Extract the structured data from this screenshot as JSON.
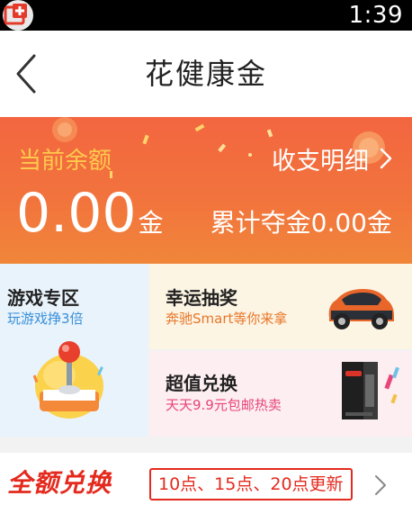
{
  "status_bar": {
    "time": "1:39",
    "app_icon": "app-plus-icon"
  },
  "nav": {
    "back_icon": "back-chevron-icon",
    "title": "花健康金"
  },
  "balance": {
    "label": "当前余额",
    "details_label": "收支明细",
    "amount": "0.00",
    "unit": "金",
    "total_won": "累计夺金0.00金",
    "colors": {
      "label": "#ffc94d",
      "banner_top": "#f36640",
      "banner_bottom": "#f0863a"
    }
  },
  "tiles": {
    "game": {
      "title": "游戏专区",
      "subtitle": "玩游戏挣3倍",
      "subtitle_color": "#3a8fd8",
      "icon": "joystick-icon"
    },
    "lottery": {
      "title": "幸运抽奖",
      "subtitle": "奔驰Smart等你来拿",
      "subtitle_color": "#e8762a",
      "icon": "smart-car-icon"
    },
    "exchange": {
      "title": "超值兑换",
      "subtitle": "天天9.9元包邮热卖",
      "subtitle_color": "#e8457a",
      "icon": "product-box-icon"
    }
  },
  "bottom": {
    "title": "全额兑换",
    "schedule": "10点、15点、20点更新",
    "accent": "#e42a1e",
    "chevron_icon": "chevron-right-icon"
  }
}
